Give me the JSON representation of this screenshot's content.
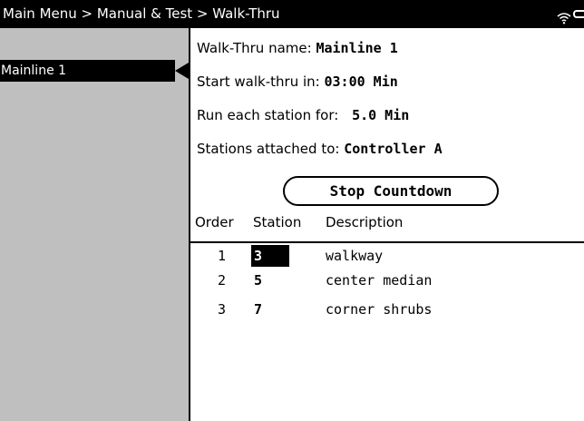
{
  "header": {
    "breadcrumb": "Main Menu > Manual & Test > Walk-Thru",
    "wifi_icon": "wifi-icon",
    "battery_icon": "battery-icon"
  },
  "sidebar": {
    "items": [
      {
        "label": "Mainline 1",
        "selected": true
      }
    ]
  },
  "details": {
    "name_label": "Walk-Thru name:",
    "name_value": "Mainline 1",
    "start_label": "Start walk-thru in:",
    "start_value": "03:00 Min",
    "run_label": "Run each station for:",
    "run_value": "5.0 Min",
    "attached_label": "Stations attached to:",
    "attached_value": "Controller A"
  },
  "stop_button": {
    "label": "Stop Countdown"
  },
  "table": {
    "headers": [
      "Order",
      "Station",
      "Description"
    ],
    "rows": [
      {
        "order": "1",
        "station": "3",
        "description": "walkway",
        "selected": true
      },
      {
        "order": "2",
        "station": "5",
        "description": "center median"
      },
      {
        "order": "3",
        "station": "7",
        "description": "corner shrubs"
      }
    ]
  }
}
